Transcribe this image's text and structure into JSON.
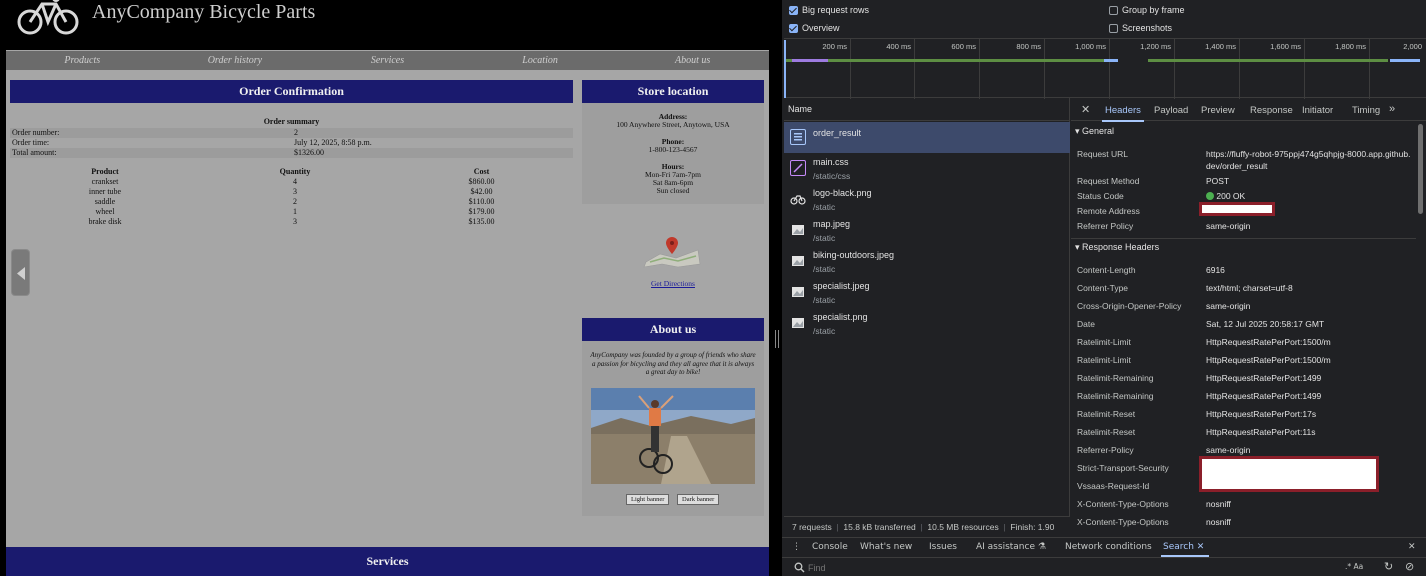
{
  "site": {
    "title": "AnyCompany Bicycle Parts",
    "nav": [
      "Products",
      "Order history",
      "Services",
      "Location",
      "About us"
    ]
  },
  "order": {
    "heading": "Order Confirmation",
    "summary_title": "Order summary",
    "summary": [
      {
        "label": "Order number:",
        "value": "2"
      },
      {
        "label": "Order time:",
        "value": "July 12, 2025, 8:58 p.m."
      },
      {
        "label": "Total amount:",
        "value": "$1326.00"
      }
    ],
    "columns": [
      "Product",
      "Quantity",
      "Cost"
    ],
    "items": [
      {
        "product": "crankset",
        "quantity": "4",
        "cost": "$860.00"
      },
      {
        "product": "inner tube",
        "quantity": "3",
        "cost": "$42.00"
      },
      {
        "product": "saddle",
        "quantity": "2",
        "cost": "$110.00"
      },
      {
        "product": "wheel",
        "quantity": "1",
        "cost": "$179.00"
      },
      {
        "product": "brake disk",
        "quantity": "3",
        "cost": "$135.00"
      }
    ]
  },
  "store": {
    "heading": "Store location",
    "address_label": "Address:",
    "address": "100 Anywhere Street, Anytown, USA",
    "phone_label": "Phone:",
    "phone": "1-800-123-4567",
    "hours_label": "Hours:",
    "hours": [
      "Mon-Fri 7am-7pm",
      "Sat 8am-6pm",
      "Sun closed"
    ],
    "directions": "Get Directions"
  },
  "about": {
    "heading": "About us",
    "text": "AnyCompany was founded by a group of friends who share a passion for bicycling and they all agree that it is always a great day to bike!",
    "light_banner": "Light banner",
    "dark_banner": "Dark banner"
  },
  "services": {
    "heading": "Services"
  },
  "devtools": {
    "options": {
      "big_request_rows": "Big request rows",
      "overview": "Overview",
      "group_by_frame": "Group by frame",
      "screenshots": "Screenshots"
    },
    "ticks": [
      "200 ms",
      "400 ms",
      "600 ms",
      "800 ms",
      "1,000 ms",
      "1,200 ms",
      "1,400 ms",
      "1,600 ms",
      "1,800 ms",
      "2,000"
    ],
    "name_header": "Name",
    "requests": [
      {
        "name": "order_result",
        "path": ""
      },
      {
        "name": "main.css",
        "path": "/static/css"
      },
      {
        "name": "logo-black.png",
        "path": "/static"
      },
      {
        "name": "map.jpeg",
        "path": "/static"
      },
      {
        "name": "biking-outdoors.jpeg",
        "path": "/static"
      },
      {
        "name": "specialist.jpeg",
        "path": "/static"
      },
      {
        "name": "specialist.png",
        "path": "/static"
      }
    ],
    "status": {
      "requests": "7 requests",
      "transferred": "15.8 kB transferred",
      "resources": "10.5 MB resources",
      "finish": "Finish: 1.90"
    },
    "tabs": [
      "Headers",
      "Payload",
      "Preview",
      "Response",
      "Initiator",
      "Timing"
    ],
    "general_title": "General",
    "general": [
      {
        "k": "Request URL",
        "v": "https://fluffy-robot-975ppj474g5qhpjg-8000.app.github.dev/order_result"
      },
      {
        "k": "Request Method",
        "v": "POST"
      },
      {
        "k": "Status Code",
        "v": "200 OK"
      },
      {
        "k": "Remote Address",
        "v": ""
      },
      {
        "k": "Referrer Policy",
        "v": "same-origin"
      }
    ],
    "response_title": "Response Headers",
    "response": [
      {
        "k": "Content-Length",
        "v": "6916"
      },
      {
        "k": "Content-Type",
        "v": "text/html; charset=utf-8"
      },
      {
        "k": "Cross-Origin-Opener-Policy",
        "v": "same-origin"
      },
      {
        "k": "Date",
        "v": "Sat, 12 Jul 2025 20:58:17 GMT"
      },
      {
        "k": "Ratelimit-Limit",
        "v": "HttpRequestRatePerPort:1500/m"
      },
      {
        "k": "Ratelimit-Limit",
        "v": "HttpRequestRatePerPort:1500/m"
      },
      {
        "k": "Ratelimit-Remaining",
        "v": "HttpRequestRatePerPort:1499"
      },
      {
        "k": "Ratelimit-Remaining",
        "v": "HttpRequestRatePerPort:1499"
      },
      {
        "k": "Ratelimit-Reset",
        "v": "HttpRequestRatePerPort:17s"
      },
      {
        "k": "Ratelimit-Reset",
        "v": "HttpRequestRatePerPort:11s"
      },
      {
        "k": "Referrer-Policy",
        "v": "same-origin"
      },
      {
        "k": "Strict-Transport-Security",
        "v": ""
      },
      {
        "k": "Vssaas-Request-Id",
        "v": ""
      },
      {
        "k": "X-Content-Type-Options",
        "v": "nosniff"
      },
      {
        "k": "X-Content-Type-Options",
        "v": "nosniff"
      }
    ],
    "drawer_tabs": [
      "Console",
      "What's new",
      "Issues",
      "AI assistance",
      "Network conditions",
      "Search"
    ],
    "find_placeholder": "Find",
    "find_options": ".* Aa",
    "colors": {
      "accent": "#a8c7fa",
      "selected_row": "#3d4a6b",
      "status_ok": "#4caf50",
      "page_band": "#1a1a6e"
    }
  }
}
